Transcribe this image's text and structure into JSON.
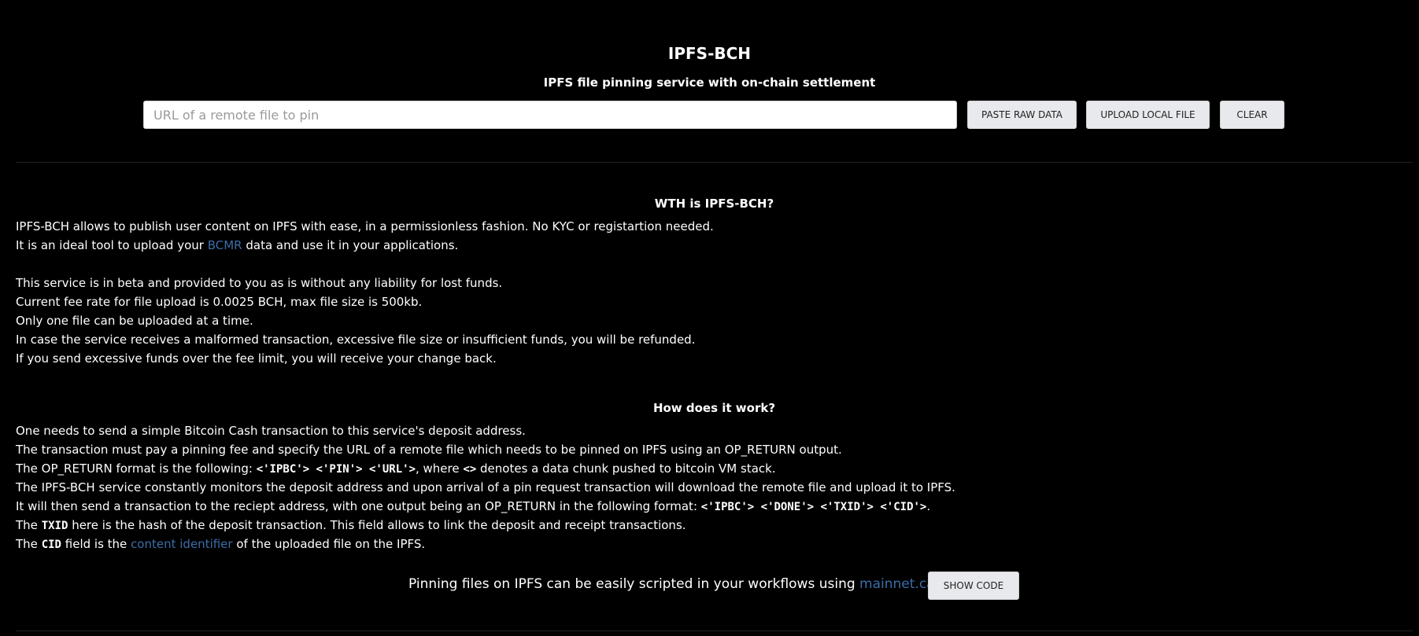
{
  "header": {
    "title": "IPFS-BCH",
    "subtitle": "IPFS file pinning service with on-chain settlement"
  },
  "toolbar": {
    "url_placeholder": "URL of a remote file to pin",
    "url_value": "",
    "paste_label": "PASTE RAW DATA",
    "upload_label": "UPLOAD LOCAL FILE",
    "clear_label": "CLEAR"
  },
  "about": {
    "heading": "WTH is IPFS-BCH?",
    "line1": "IPFS-BCH allows to publish user content on IPFS with ease, in a permissionless fashion. No KYC or registartion needed.",
    "line2_pre": "It is an ideal tool to upload your",
    "line2_link": "BCMR",
    "line2_post": "data and use it in your applications.",
    "line3": "This service is in beta and provided to you as is without any liability for lost funds.",
    "line4": "Current fee rate for file upload is 0.0025 BCH, max file size is 500kb.",
    "line5": "Only one file can be uploaded at a time.",
    "line6": "In case the service receives a malformed transaction, excessive file size or insufficient funds, you will be refunded.",
    "line7": "If you send excessive funds over the fee limit, you will receive your change back."
  },
  "how": {
    "heading": "How does it work?",
    "line1": "One needs to send a simple Bitcoin Cash transaction to this service's deposit address.",
    "line2": "The transaction must pay a pinning fee and specify the URL of a remote file which needs to be pinned on IPFS using an OP_RETURN output.",
    "line3_pre": "The OP_RETURN format is the following:",
    "line3_code": "<'IPBC'> <'PIN'> <'URL'>",
    "line3_mid": ", where",
    "line3_code2": "<>",
    "line3_post": "denotes a data chunk pushed to bitcoin VM stack.",
    "line4": "The IPFS-BCH service constantly monitors the deposit address and upon arrival of a pin request transaction will download the remote file and upload it to IPFS.",
    "line5_pre": "It will then send a transaction to the reciept address, with one output being an OP_RETURN in the following format:",
    "line5_code": "<'IPBC'> <'DONE'> <'TXID'> <'CID'>",
    "line5_post": ".",
    "line6_pre": "The",
    "line6_code": "TXID",
    "line6_post": "here is the hash of the deposit transaction. This field allows to link the deposit and receipt transactions.",
    "line7_pre": "The",
    "line7_code": "CID",
    "line7_mid": "field is the",
    "line7_link": "content identifier",
    "line7_post": "of the uploaded file on the IPFS."
  },
  "footer": {
    "text": "Pinning files on IPFS can be easily scripted in your workflows using",
    "link": "mainnet.cash",
    "show_code_label": "SHOW CODE"
  }
}
